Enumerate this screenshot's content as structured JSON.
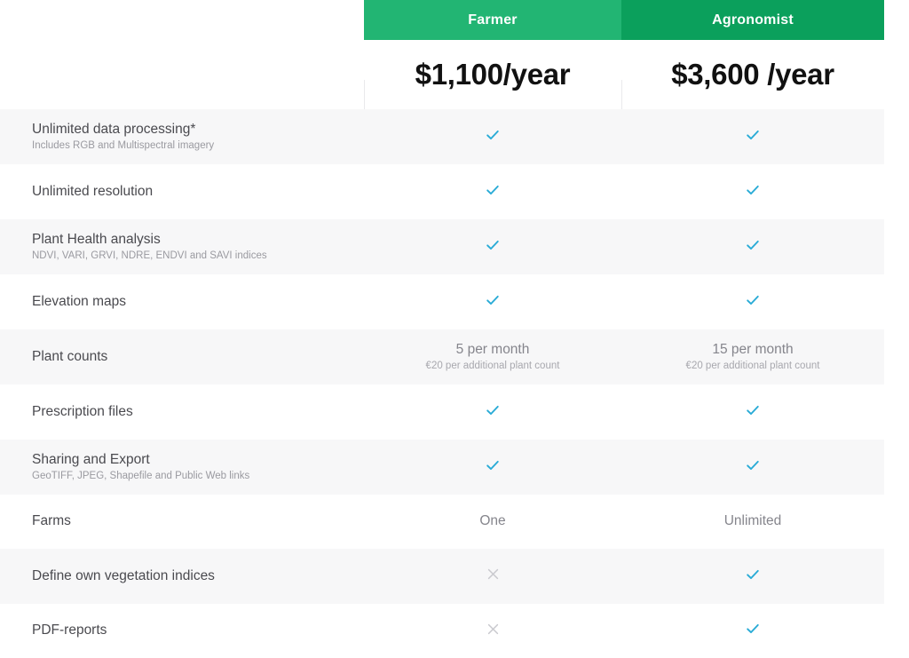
{
  "colors": {
    "farmer_header_bg": "#22b573",
    "agronomist_header_bg": "#0ba05c",
    "header_text": "#ffffff",
    "price_text": "#111111",
    "check": "#29abd6",
    "cross": "#c9c9ce",
    "row_tint": "#f7f7f8",
    "row_plain": "#ffffff",
    "divider": "#e9e9ec",
    "feature_title": "#4a4a4f",
    "feature_sub": "#9a9aa0",
    "value_text": "#85858c"
  },
  "plans": [
    {
      "name": "Farmer",
      "price": "$1,100/year"
    },
    {
      "name": "Agronomist",
      "price": "$3,600 /year"
    }
  ],
  "features": [
    {
      "title": "Unlimited data processing*",
      "sub": "Includes RGB and Multispectral imagery",
      "farmer": {
        "type": "check"
      },
      "agronomist": {
        "type": "check"
      }
    },
    {
      "title": "Unlimited resolution",
      "sub": "",
      "farmer": {
        "type": "check"
      },
      "agronomist": {
        "type": "check"
      }
    },
    {
      "title": "Plant Health analysis",
      "sub": "NDVI, VARI, GRVI, NDRE, ENDVI and SAVI indices",
      "farmer": {
        "type": "check"
      },
      "agronomist": {
        "type": "check"
      }
    },
    {
      "title": "Elevation maps",
      "sub": "",
      "farmer": {
        "type": "check"
      },
      "agronomist": {
        "type": "check"
      }
    },
    {
      "title": "Plant counts",
      "sub": "",
      "farmer": {
        "type": "text",
        "text": "5 per month",
        "sub": "€20 per additional plant count"
      },
      "agronomist": {
        "type": "text",
        "text": "15 per month",
        "sub": "€20 per additional plant count"
      }
    },
    {
      "title": "Prescription files",
      "sub": "",
      "farmer": {
        "type": "check"
      },
      "agronomist": {
        "type": "check"
      }
    },
    {
      "title": "Sharing and Export",
      "sub": "GeoTIFF, JPEG, Shapefile and Public Web links",
      "farmer": {
        "type": "check"
      },
      "agronomist": {
        "type": "check"
      }
    },
    {
      "title": "Farms",
      "sub": "",
      "farmer": {
        "type": "text",
        "text": "One",
        "sub": ""
      },
      "agronomist": {
        "type": "text",
        "text": "Unlimited",
        "sub": ""
      }
    },
    {
      "title": "Define own vegetation indices",
      "sub": "",
      "farmer": {
        "type": "cross"
      },
      "agronomist": {
        "type": "check"
      }
    },
    {
      "title": "PDF-reports",
      "sub": "",
      "farmer": {
        "type": "cross"
      },
      "agronomist": {
        "type": "check"
      }
    }
  ],
  "icons": {
    "check": "check-icon",
    "cross": "cross-icon"
  }
}
